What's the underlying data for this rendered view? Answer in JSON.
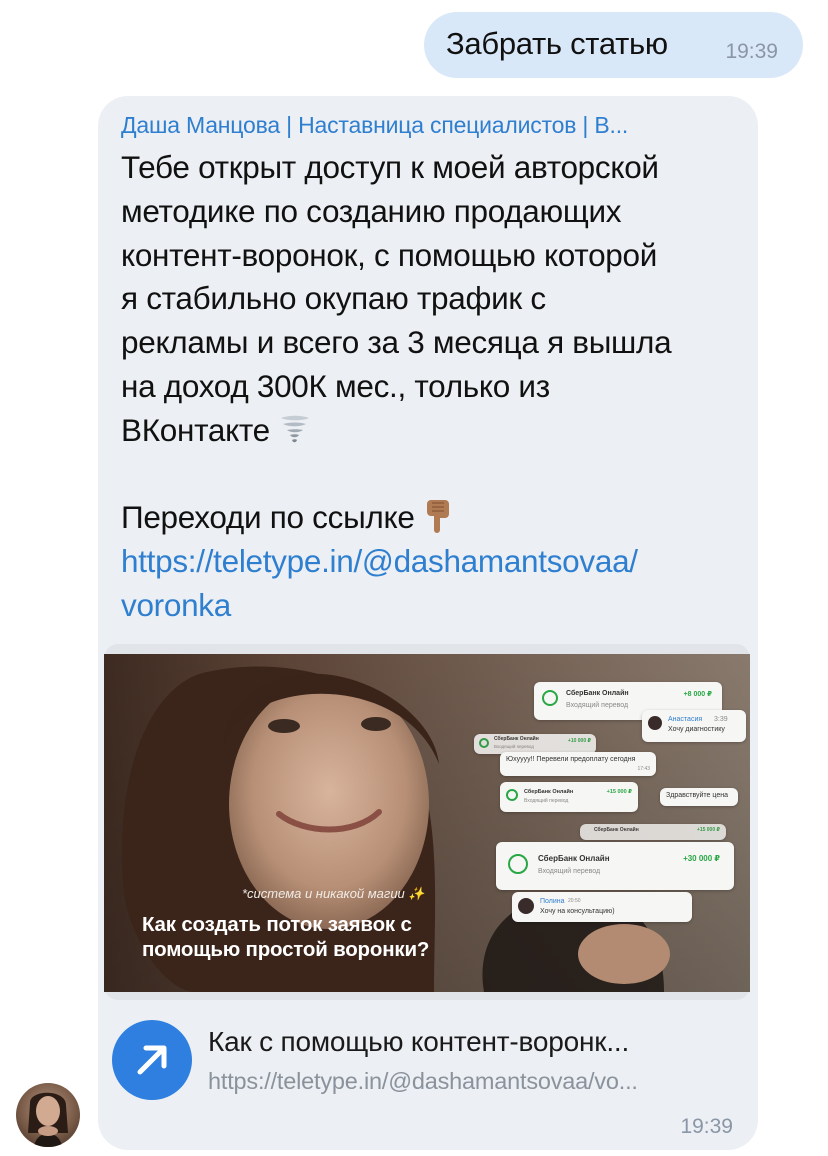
{
  "outgoing": {
    "text": "Забрать статью",
    "time": "19:39"
  },
  "incoming": {
    "sender": "Даша Манцова | Наставница специалистов | В...",
    "lines": [
      "Тебе открыт доступ к моей авторской",
      "методике по созданию продающих",
      "контент-воронок, с помощью которой",
      "я стабильно окупаю трафик с",
      "рекламы и всего за 3 месяца я вышла",
      "на доход 300К мес., только из",
      "ВКонтакте"
    ],
    "cta": "Переходи по ссылке",
    "link_line1": "https://teletype.in/@dashamantsovaa/",
    "link_line2": "voronka",
    "tornado_emoji": "tornado-icon",
    "pointing_emoji": "pointing-down-icon",
    "time": "19:39",
    "preview": {
      "caption": "*система и никакой магии ✨",
      "title_line1": "Как создать поток заявок с",
      "title_line2": "помощью простой воронки?",
      "cards": [
        {
          "name": "СберБанк Онлайн",
          "sub": "Входящий перевод",
          "amount": "+8 000 ₽"
        },
        {
          "name": "Анастасия",
          "time": "3:39",
          "sub": "Хочу диагностику"
        },
        {
          "name": "СберБанк Онлайн",
          "sub": "Входящий перевод",
          "amount": "+10 000 ₽"
        },
        {
          "text": "Юхуууу!! Перевели предоплату сегодня",
          "time": "17:43"
        },
        {
          "name": "СберБанк Онлайн",
          "sub": "Входящий перевод",
          "amount": "+15 000 ₽"
        },
        {
          "text": "Здравствуйте цена"
        },
        {
          "name": "СберБанк Онлайн",
          "amount": "+15 000 ₽"
        },
        {
          "name": "СберБанк Онлайн",
          "sub": "Входящий перевод",
          "amount": "+30 000 ₽"
        },
        {
          "name": "Полина",
          "time": "20:50",
          "sub": "Хочу на консультацию)"
        }
      ]
    },
    "link_card": {
      "icon": "arrow-up-right-icon",
      "title": "Как с помощью контент-воронк...",
      "url": "https://teletype.in/@dashamantsovaa/vo..."
    }
  },
  "colors": {
    "accent": "#2f7fd0",
    "outgoing_bubble": "#d9e8f8",
    "incoming_bubble": "#eceff3",
    "link_icon_bg": "#2f7fe0"
  }
}
